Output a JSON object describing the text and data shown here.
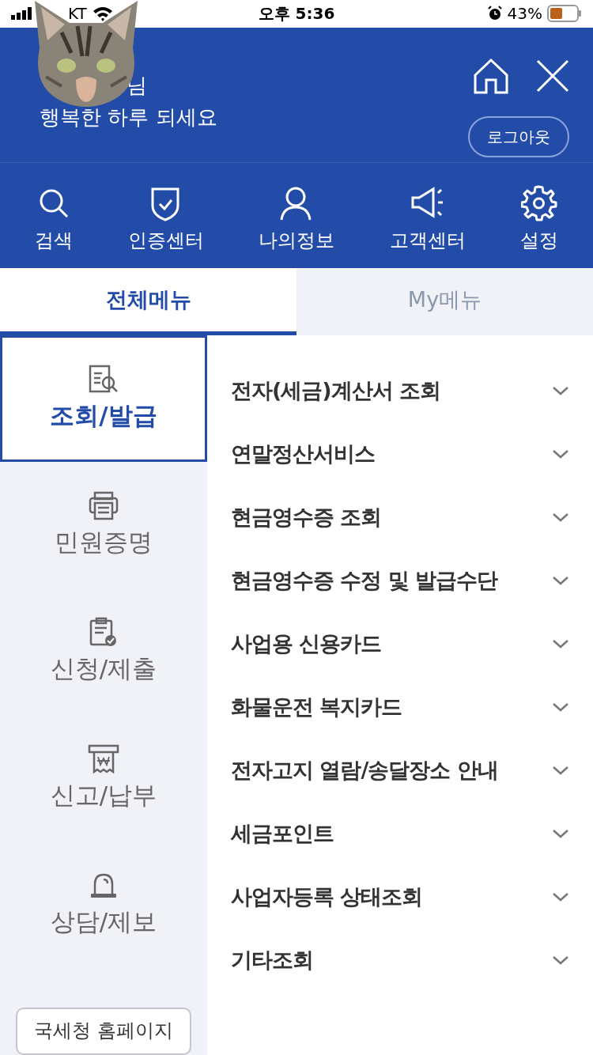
{
  "status_bar": {
    "carrier": "KT",
    "time": "오후 5:36",
    "battery": "43%"
  },
  "header": {
    "greeting_name": "님",
    "greeting": "행복한 하루 되세요",
    "logout": "로그아웃"
  },
  "quick_menu": [
    {
      "kind": "search",
      "label": "검색"
    },
    {
      "kind": "shield",
      "label": "인증센터"
    },
    {
      "kind": "person",
      "label": "나의정보"
    },
    {
      "kind": "megaphone",
      "label": "고객센터"
    },
    {
      "kind": "gear",
      "label": "설정"
    }
  ],
  "tabs": [
    {
      "label": "전체메뉴",
      "selected": true
    },
    {
      "label": "My메뉴",
      "selected": false
    }
  ],
  "sidebar": {
    "items": [
      {
        "kind": "lookup",
        "label": "조회/발급",
        "selected": true
      },
      {
        "kind": "printer",
        "label": "민원증명",
        "selected": false
      },
      {
        "kind": "clipboard",
        "label": "신청/제출",
        "selected": false
      },
      {
        "kind": "receipt",
        "label": "신고/납부",
        "selected": false
      },
      {
        "kind": "siren",
        "label": "상담/제보",
        "selected": false
      }
    ],
    "link": "국세청 홈페이지"
  },
  "menu": [
    "전자(세금)계산서 조회",
    "연말정산서비스",
    "현금영수증 조회",
    "현금영수증 수정 및 발급수단",
    "사업용 신용카드",
    "화물운전 복지카드",
    "전자고지 열람/송달장소 안내",
    "세금포인트",
    "사업자등록 상태조회",
    "기타조회"
  ]
}
